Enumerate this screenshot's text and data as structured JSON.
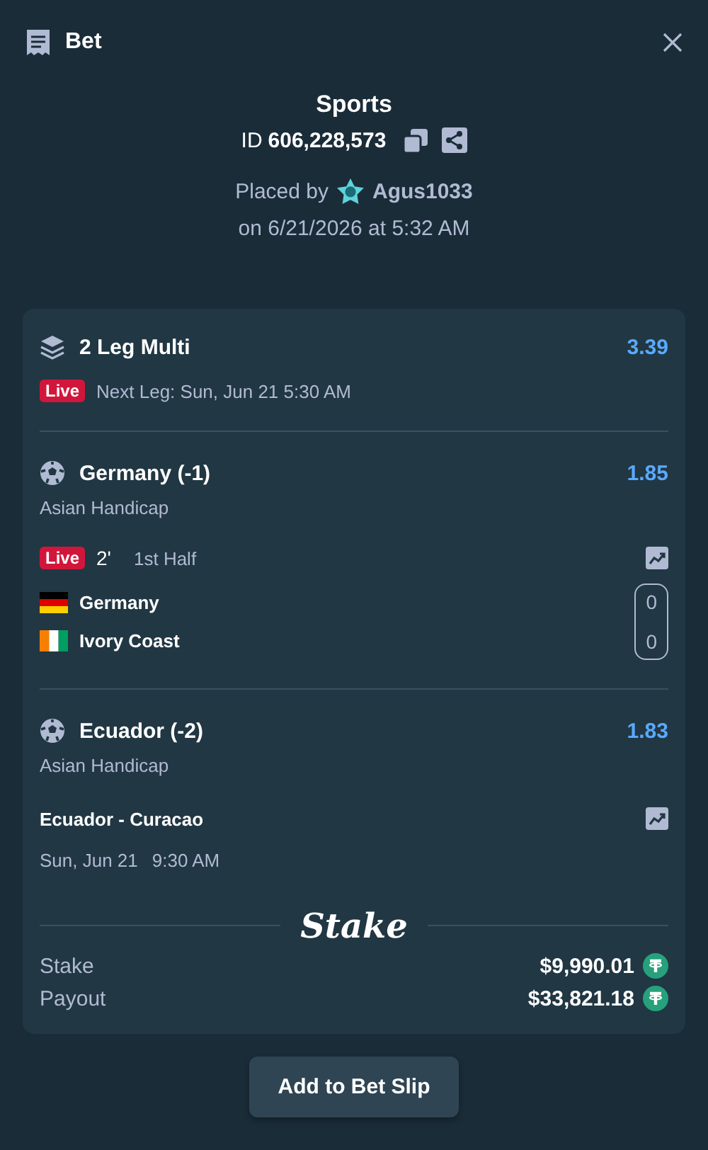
{
  "header": {
    "title": "Bet"
  },
  "summary": {
    "category": "Sports",
    "id_label": "ID",
    "id_value": "606,228,573",
    "placed_by_label": "Placed by",
    "username": "Agus1033",
    "placed_on": "on 6/21/2026 at 5:32 AM"
  },
  "multi": {
    "title": "2 Leg Multi",
    "odds": "3.39",
    "live_badge": "Live",
    "next_leg": "Next Leg: Sun, Jun 21 5:30 AM"
  },
  "legs": [
    {
      "kind": "live",
      "selection": "Germany (-1)",
      "odds": "1.85",
      "market": "Asian Handicap",
      "live_badge": "Live",
      "minute": "2'",
      "period": "1st Half",
      "teams": [
        {
          "name": "Germany",
          "score": "0"
        },
        {
          "name": "Ivory Coast",
          "score": "0"
        }
      ]
    },
    {
      "kind": "scheduled",
      "selection": "Ecuador (-2)",
      "odds": "1.83",
      "market": "Asian Handicap",
      "fixture": "Ecuador - Curacao",
      "date": "Sun, Jun 21",
      "time": "9:30 AM"
    }
  ],
  "logo": "Stake",
  "totals": [
    {
      "label": "Stake",
      "amount": "$9,990.01"
    },
    {
      "label": "Payout",
      "amount": "$33,821.18"
    }
  ],
  "button": "Add to Bet Slip"
}
